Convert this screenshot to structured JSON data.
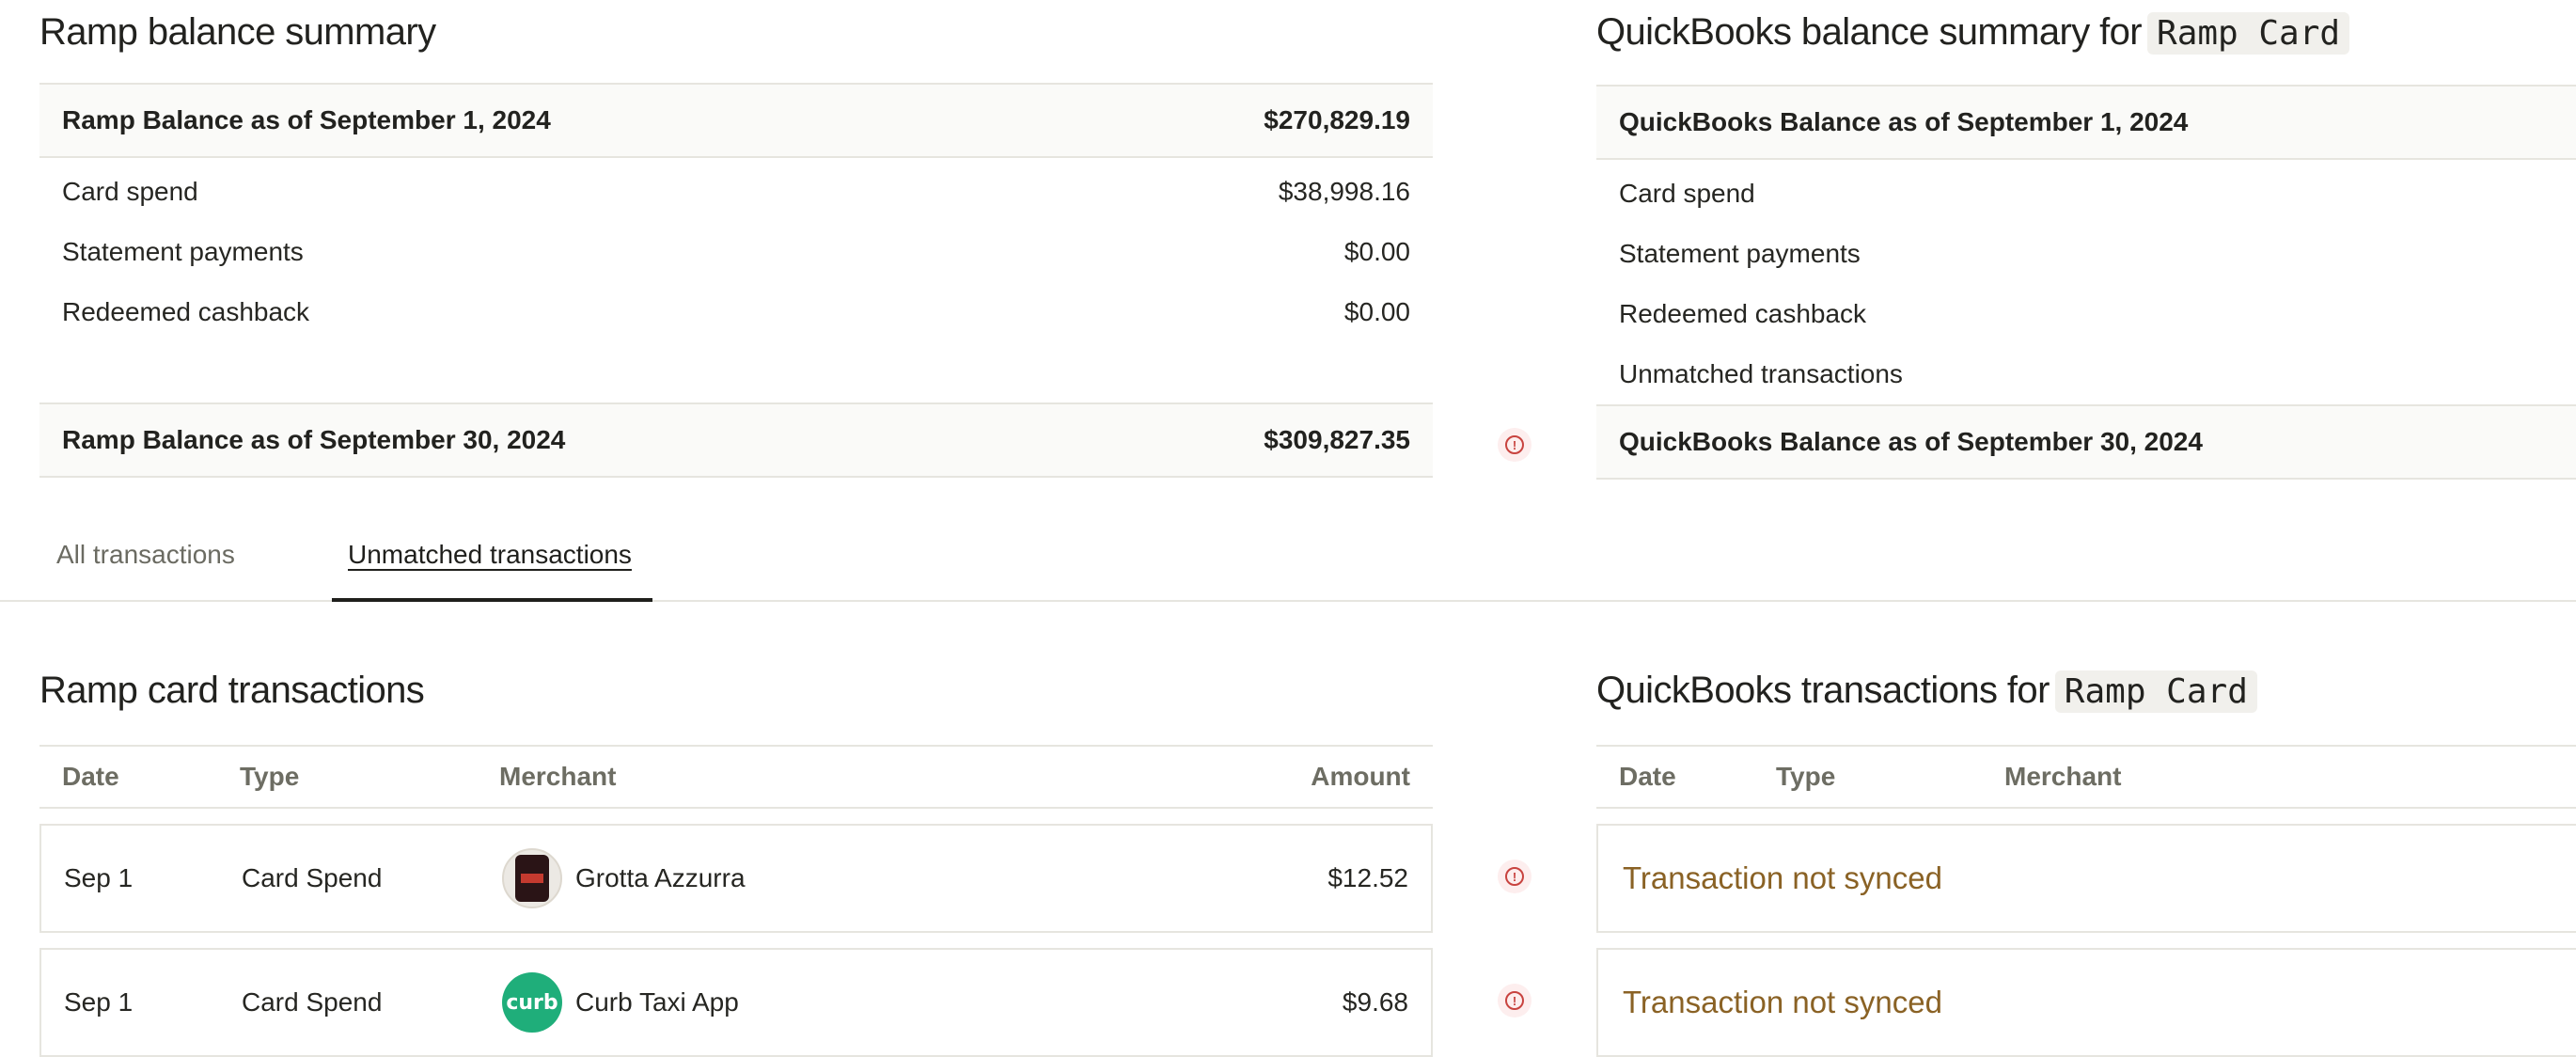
{
  "ramp_summary": {
    "title": "Ramp balance summary",
    "opening_label": "Ramp Balance as of September 1, 2024",
    "opening_value": "$270,829.19",
    "rows": [
      {
        "label": "Card spend",
        "value": "$38,998.16"
      },
      {
        "label": "Statement payments",
        "value": "$0.00"
      },
      {
        "label": "Redeemed cashback",
        "value": "$0.00"
      }
    ],
    "closing_label": "Ramp Balance as of September 30, 2024",
    "closing_value": "$309,827.35"
  },
  "qb_summary": {
    "title_prefix": "QuickBooks balance summary for",
    "account": "Ramp Card",
    "opening_label": "QuickBooks Balance as of September 1, 2024",
    "rows": [
      {
        "label": "Card spend"
      },
      {
        "label": "Statement payments"
      },
      {
        "label": "Redeemed cashback"
      },
      {
        "label": "Unmatched transactions"
      }
    ],
    "closing_label": "QuickBooks Balance as of September 30, 2024"
  },
  "tabs": [
    {
      "label": "All transactions",
      "active": false
    },
    {
      "label": "Unmatched transactions",
      "active": true
    }
  ],
  "ramp_transactions": {
    "title": "Ramp card transactions",
    "columns": [
      "Date",
      "Type",
      "Merchant",
      "Amount"
    ],
    "rows": [
      {
        "date": "Sep 1",
        "type": "Card Spend",
        "merchant": "Grotta Azzurra",
        "amount": "$12.52",
        "logo": "grotta-azzurra-logo"
      },
      {
        "date": "Sep 1",
        "type": "Card Spend",
        "merchant": "Curb Taxi App",
        "amount": "$9.68",
        "logo": "curb-logo",
        "logo_text": "curb"
      }
    ]
  },
  "qb_transactions": {
    "title_prefix": "QuickBooks transactions for",
    "account": "Ramp Card",
    "columns": [
      "Date",
      "Type",
      "Merchant"
    ],
    "rows": [
      {
        "status": "Transaction not synced"
      },
      {
        "status": "Transaction not synced"
      }
    ]
  },
  "icons": {
    "warning": "exclamation-circle-icon"
  },
  "colors": {
    "warning": "#c8433f",
    "not_synced_text": "#8a6225",
    "curb_green": "#1fae7a"
  }
}
